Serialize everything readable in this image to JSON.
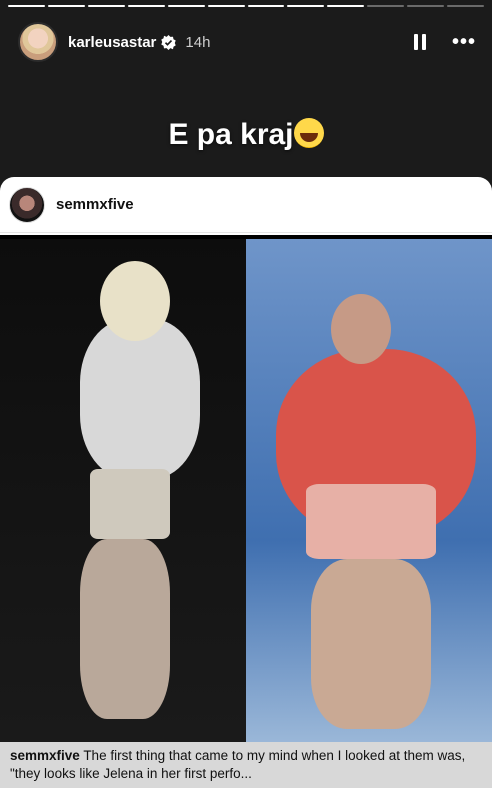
{
  "story": {
    "progress_total": 12,
    "progress_done": 9,
    "username": "karleusastar",
    "time": "14h",
    "caption_text": "E pa kraj",
    "caption_emoji": "face-with-tears-of-joy"
  },
  "shared_post": {
    "username": "semmxfive",
    "caption_user": "semmxfive",
    "caption_text": "The first thing that came to my mind when I looked at them was, \"they looks like Jelena in her first perfo..."
  }
}
